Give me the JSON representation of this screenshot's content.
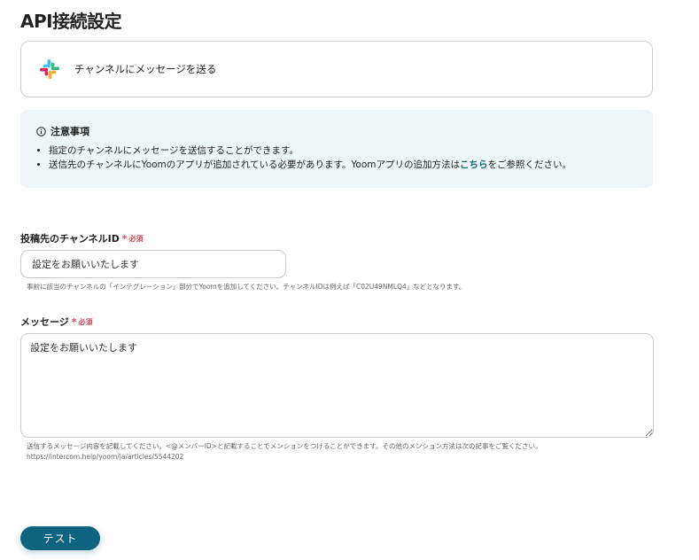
{
  "page": {
    "title": "API接続設定"
  },
  "action": {
    "icon": "slack-icon",
    "label": "チャンネルにメッセージを送る"
  },
  "notice": {
    "icon": "info-icon",
    "title": "注意事項",
    "items": [
      "指定のチャンネルにメッセージを送信することができます。",
      "送信先のチャンネルにYoomのアプリが追加されている必要があります。Yoomアプリの追加方法は"
    ],
    "link_text": "こちら",
    "item2_suffix": "をご参照ください。"
  },
  "fields": {
    "channel_id": {
      "label": "投稿先のチャンネルID",
      "required_mark": "*",
      "required_text": "必須",
      "value": "設定をお願いいたします",
      "help": "事前に該当のチャンネルの「インテグレーション」部分でYoomを追加してください。チャンネルIDは例えば「C02U49NMLQ4」などとなります。"
    },
    "message": {
      "label": "メッセージ",
      "required_mark": "*",
      "required_text": "必須",
      "value": "設定をお願いいたします",
      "help_line1": "送信するメッセージ内容を記載してください。<@メンバーID>と記載することでメンションをつけることができます。その他のメンション方法は次の記事をご覧ください。",
      "help_line2": "https://intercom.help/yoom/ja/articles/5544202"
    }
  },
  "buttons": {
    "test_label": "テスト"
  },
  "colors": {
    "accent": "#0e6380",
    "link": "#0f6a84",
    "required": "#e0465b",
    "notice_bg": "#eef7f7"
  }
}
